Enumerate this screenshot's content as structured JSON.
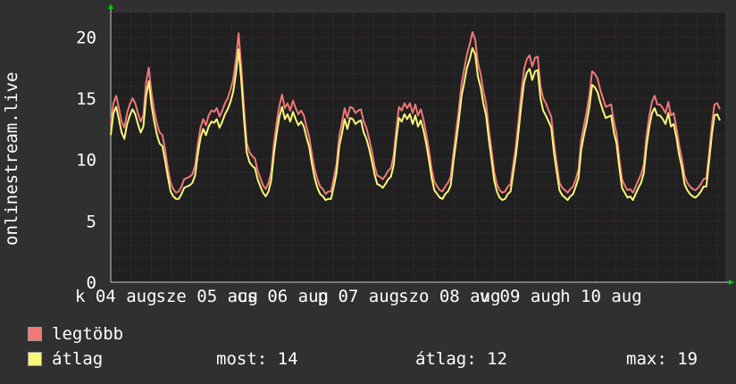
{
  "chart_data": {
    "type": "line",
    "ylabel": "onlinestream.live",
    "ylim": [
      0,
      22
    ],
    "yticks": [
      0,
      5,
      10,
      15,
      20
    ],
    "grid": true,
    "x_ticks": [
      {
        "label": "k 04 aug"
      },
      {
        "label": "sze 05 aug"
      },
      {
        "label": "cs 06 aug"
      },
      {
        "label": "p 07 aug"
      },
      {
        "label": "szo 08 aug"
      },
      {
        "label": "v 09 aug"
      },
      {
        "label": "h 10 aug"
      }
    ],
    "x_range_days": 7.6,
    "series": [
      {
        "name": "legtöbb",
        "color": "#f07878",
        "values": [
          12.8,
          14.6,
          15.2,
          14.2,
          13.1,
          12.6,
          13.8,
          14.5,
          15.0,
          14.6,
          13.8,
          13.1,
          13.6,
          16.3,
          17.5,
          15.4,
          14.0,
          12.9,
          12.2,
          12.0,
          10.8,
          9.3,
          8.1,
          7.6,
          7.3,
          7.4,
          7.8,
          8.4,
          8.5,
          8.6,
          8.8,
          9.5,
          11.2,
          12.6,
          13.3,
          12.8,
          13.6,
          14.0,
          13.9,
          14.2,
          13.5,
          14.0,
          14.6,
          15.0,
          15.7,
          16.5,
          18.1,
          20.3,
          17.6,
          14.2,
          11.4,
          10.6,
          10.3,
          10.1,
          9.1,
          8.5,
          7.9,
          7.6,
          8.1,
          9.0,
          11.3,
          13.0,
          14.4,
          15.3,
          14.2,
          14.6,
          14.0,
          14.8,
          14.2,
          13.7,
          14.0,
          13.6,
          12.7,
          11.8,
          10.4,
          9.2,
          8.4,
          7.8,
          7.6,
          7.2,
          7.4,
          7.4,
          8.5,
          9.6,
          11.9,
          13.0,
          14.2,
          13.4,
          14.3,
          14.2,
          13.8,
          14.0,
          14.1,
          13.1,
          12.6,
          11.7,
          10.7,
          9.5,
          8.7,
          8.6,
          8.4,
          8.7,
          9.1,
          9.3,
          10.3,
          12.5,
          14.3,
          14.0,
          14.6,
          14.2,
          14.6,
          13.8,
          14.5,
          13.6,
          14.1,
          13.3,
          12.1,
          10.8,
          9.2,
          8.2,
          7.8,
          7.5,
          7.4,
          7.8,
          8.1,
          8.6,
          10.5,
          12.3,
          14.1,
          16.2,
          17.4,
          18.6,
          19.4,
          20.4,
          19.8,
          17.9,
          17.0,
          15.6,
          14.6,
          12.5,
          10.8,
          9.0,
          8.0,
          7.5,
          7.3,
          7.4,
          7.8,
          8.0,
          9.6,
          11.2,
          13.3,
          15.5,
          17.4,
          18.2,
          18.5,
          17.6,
          18.3,
          18.4,
          16.0,
          15.0,
          14.6,
          14.0,
          13.5,
          11.3,
          9.7,
          8.1,
          7.7,
          7.5,
          7.3,
          7.6,
          7.8,
          8.4,
          9.2,
          11.6,
          12.8,
          13.9,
          15.3,
          17.2,
          17.0,
          16.6,
          15.7,
          15.0,
          14.3,
          14.4,
          14.5,
          13.1,
          12.1,
          10.1,
          8.4,
          7.9,
          7.5,
          7.6,
          7.3,
          7.8,
          8.3,
          8.8,
          9.6,
          11.9,
          13.5,
          14.7,
          15.2,
          14.5,
          14.5,
          14.2,
          13.8,
          14.7,
          13.6,
          13.8,
          12.6,
          11.2,
          10.1,
          8.7,
          8.1,
          7.8,
          7.6,
          7.5,
          7.7,
          8.0,
          8.4,
          8.5,
          10.5,
          12.8,
          14.5,
          14.6,
          14.1
        ]
      },
      {
        "name": "átlag",
        "color": "#f8f878",
        "values": [
          12.0,
          13.8,
          14.3,
          13.3,
          12.2,
          11.7,
          12.9,
          13.6,
          14.1,
          13.7,
          12.9,
          12.2,
          12.7,
          15.2,
          16.4,
          14.4,
          13.1,
          12.0,
          11.3,
          11.1,
          9.9,
          8.6,
          7.4,
          7.0,
          6.8,
          6.8,
          7.2,
          7.7,
          7.8,
          7.9,
          8.1,
          8.7,
          10.4,
          11.8,
          12.5,
          12.0,
          12.7,
          13.1,
          13.0,
          13.3,
          12.6,
          13.1,
          13.7,
          14.1,
          14.7,
          15.5,
          17.0,
          19.0,
          16.5,
          13.3,
          10.6,
          9.8,
          9.5,
          9.3,
          8.4,
          7.8,
          7.3,
          7.0,
          7.4,
          8.3,
          10.5,
          12.1,
          13.5,
          14.3,
          13.3,
          13.7,
          13.1,
          13.9,
          13.3,
          12.8,
          13.1,
          12.7,
          11.8,
          11.0,
          9.6,
          8.5,
          7.7,
          7.2,
          7.0,
          6.7,
          6.8,
          6.8,
          7.8,
          8.9,
          11.1,
          12.1,
          13.3,
          12.5,
          13.4,
          13.3,
          12.9,
          13.1,
          13.2,
          12.2,
          11.7,
          10.9,
          9.9,
          8.8,
          8.0,
          7.9,
          7.7,
          8.0,
          8.4,
          8.6,
          9.5,
          11.7,
          13.4,
          13.1,
          13.7,
          13.3,
          13.7,
          12.9,
          13.6,
          12.7,
          13.2,
          12.4,
          11.3,
          10.0,
          8.5,
          7.5,
          7.2,
          6.9,
          6.8,
          7.2,
          7.4,
          7.9,
          9.8,
          11.5,
          13.2,
          15.2,
          16.3,
          17.5,
          18.2,
          19.1,
          18.6,
          16.8,
          15.9,
          14.6,
          13.6,
          11.7,
          10.0,
          8.3,
          7.4,
          6.9,
          6.7,
          6.8,
          7.2,
          7.4,
          8.9,
          10.4,
          12.4,
          14.5,
          16.3,
          17.1,
          17.4,
          16.5,
          17.2,
          17.3,
          15.0,
          14.0,
          13.6,
          13.1,
          12.6,
          10.5,
          9.0,
          7.5,
          7.1,
          6.9,
          6.7,
          7.0,
          7.2,
          7.8,
          8.5,
          10.8,
          12.0,
          13.0,
          14.3,
          16.1,
          15.9,
          15.5,
          14.7,
          14.0,
          13.4,
          13.5,
          13.6,
          12.2,
          11.3,
          9.4,
          7.7,
          7.3,
          6.9,
          7.0,
          6.7,
          7.2,
          7.7,
          8.1,
          8.9,
          11.1,
          12.6,
          13.8,
          14.2,
          13.6,
          13.6,
          13.3,
          12.9,
          13.8,
          12.7,
          12.9,
          11.8,
          10.4,
          9.4,
          8.0,
          7.5,
          7.2,
          7.0,
          6.9,
          7.1,
          7.4,
          7.8,
          7.8,
          9.8,
          12.0,
          13.6,
          13.7,
          13.2
        ]
      }
    ],
    "stats": {
      "most": {
        "label": "most:",
        "value": "14"
      },
      "avg": {
        "label": "átlag:",
        "value": "12"
      },
      "max": {
        "label": "max:",
        "value": "19"
      }
    }
  }
}
